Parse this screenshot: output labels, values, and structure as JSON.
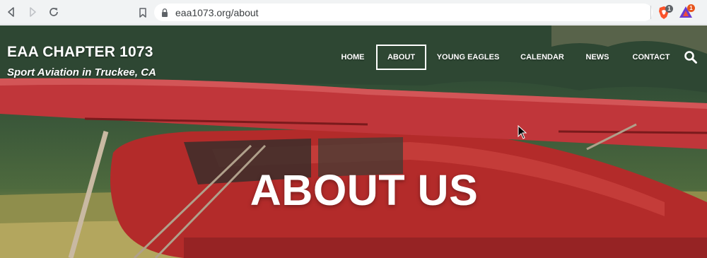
{
  "browser": {
    "url": "eaa1073.org/about",
    "extensions": {
      "brave_badge": "1",
      "rewards_badge": "1"
    }
  },
  "site": {
    "title": "EAA CHAPTER 1073",
    "tagline": "Sport Aviation in Truckee, CA"
  },
  "nav": {
    "items": [
      {
        "label": "HOME"
      },
      {
        "label": "ABOUT"
      },
      {
        "label": "YOUNG EAGLES"
      },
      {
        "label": "CALENDAR"
      },
      {
        "label": "NEWS"
      },
      {
        "label": "CONTACT"
      }
    ],
    "active": "ABOUT"
  },
  "hero": {
    "title": "ABOUT US"
  },
  "colors": {
    "plane_red": "#c8322f",
    "forest": "#2f4a35",
    "grass": "#a69a55"
  }
}
